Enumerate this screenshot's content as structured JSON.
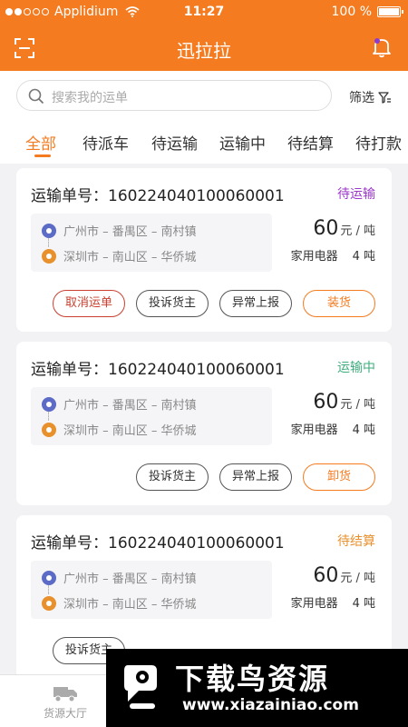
{
  "status_bar": {
    "carrier": "Applidium",
    "time": "11:27",
    "battery": "100 %"
  },
  "navbar": {
    "title": "迅拉拉",
    "left_icon": "scan-icon",
    "right_icon": "bell-icon"
  },
  "search": {
    "placeholder": "搜索我的运单",
    "filter_label": "筛选"
  },
  "tabs": [
    {
      "label": "全部",
      "active": true
    },
    {
      "label": "待派车"
    },
    {
      "label": "待运输"
    },
    {
      "label": "运输中"
    },
    {
      "label": "待结算"
    },
    {
      "label": "待打款"
    }
  ],
  "colors": {
    "brand": "#f47b20",
    "status_pending_transport": "#9b37c9",
    "status_in_transit": "#3fae7e",
    "status_pending_settle": "#e8902c",
    "cancel_red": "#c94030"
  },
  "orders": [
    {
      "title": "运输单号：160224040100060001",
      "status": "待运输",
      "from": "广州市 – 番禺区 – 南村镇",
      "to": "深圳市 – 南山区 – 华侨城",
      "price": "60",
      "unit": "元 / 吨",
      "goods": "家用电器",
      "qty": "4 吨",
      "buttons": [
        "取消运单",
        "投诉货主",
        "异常上报",
        "装货"
      ]
    },
    {
      "title": "运输单号：160224040100060001",
      "status": "运输中",
      "from": "广州市 – 番禺区 – 南村镇",
      "to": "深圳市 – 南山区 – 华侨城",
      "price": "60",
      "unit": "元 / 吨",
      "goods": "家用电器",
      "qty": "4 吨",
      "buttons": [
        "投诉货主",
        "异常上报",
        "卸货"
      ]
    },
    {
      "title": "运输单号：160224040100060001",
      "status": "待结算",
      "from": "广州市 – 番禺区 – 南村镇",
      "to": "深圳市 – 南山区 – 华侨城",
      "price": "60",
      "unit": "元 / 吨",
      "goods": "家用电器",
      "qty": "4 吨",
      "buttons": [
        "投诉货主"
      ]
    }
  ],
  "bottom_bar": {
    "items": [
      {
        "label": "货源大厅",
        "icon": "truck-icon"
      }
    ]
  },
  "watermark": {
    "text": "下载鸟资源",
    "url": "www.xiazainiao.com"
  }
}
